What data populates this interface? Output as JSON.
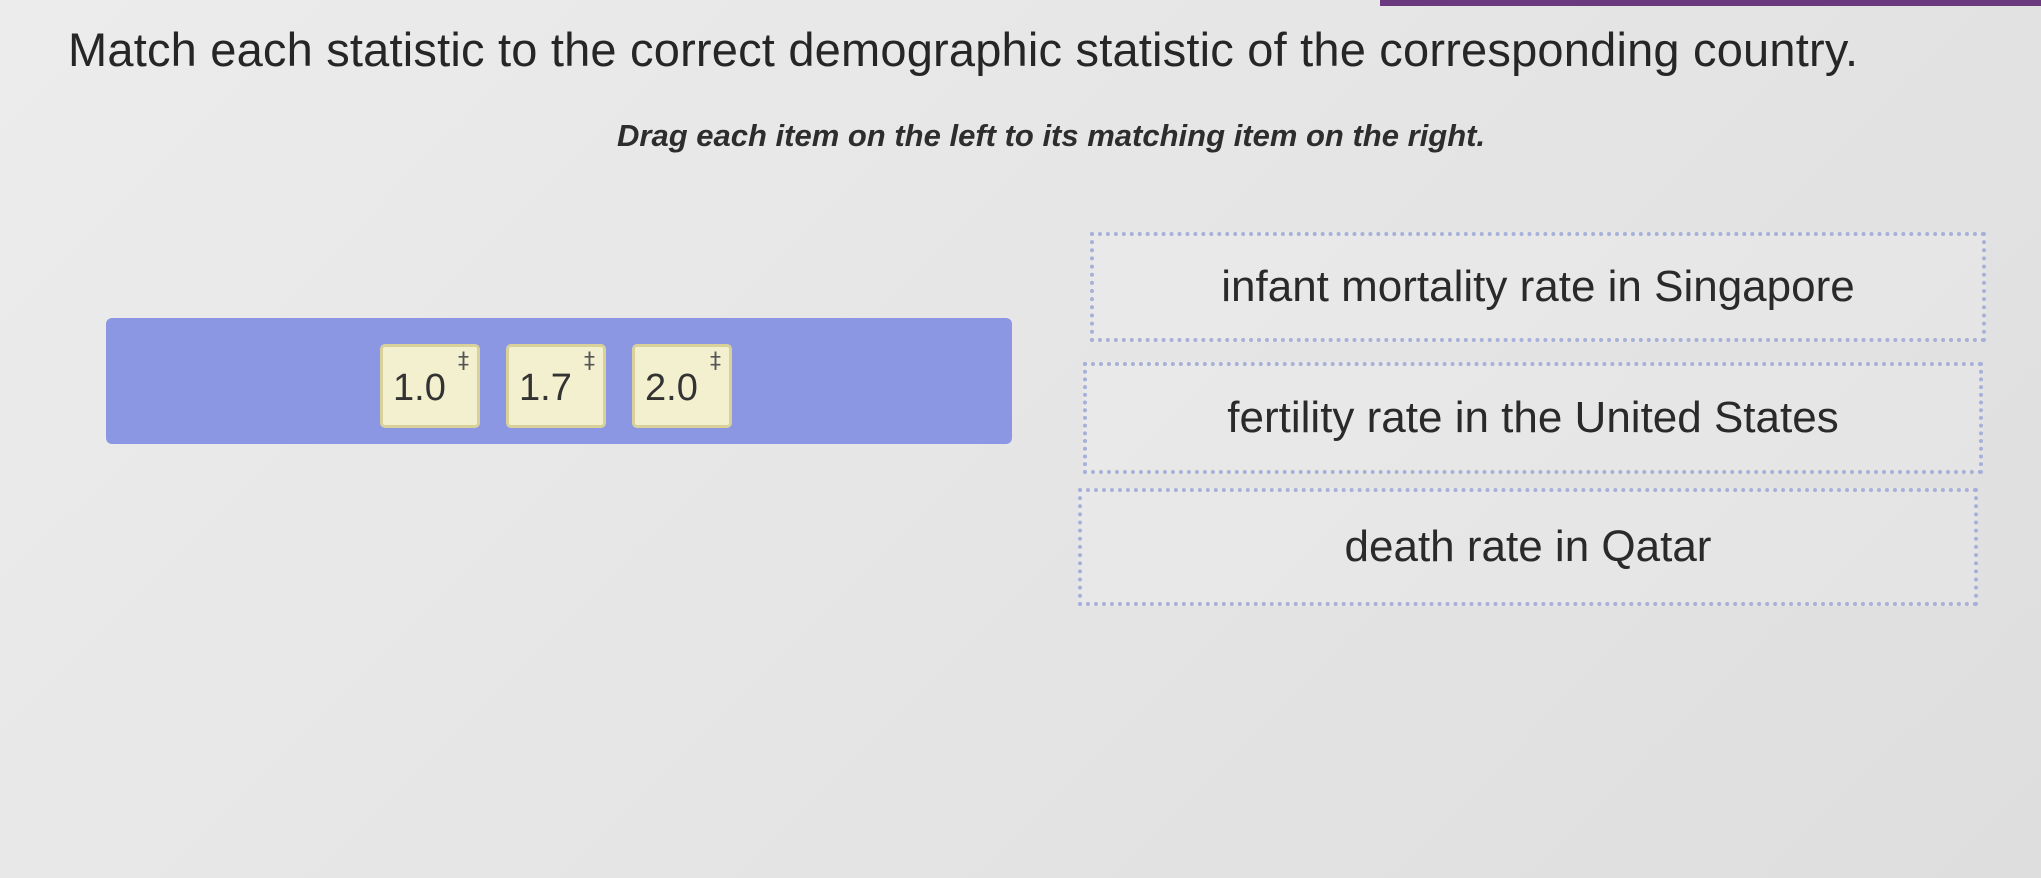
{
  "question": "Match each statistic to the correct demographic statistic of the corresponding country.",
  "instruction": "Drag each item on the left to its matching item on the right.",
  "draggables": [
    {
      "label": "1.0",
      "handle": "‡"
    },
    {
      "label": "1.7",
      "handle": "‡"
    },
    {
      "label": "2.0",
      "handle": "‡"
    }
  ],
  "targets": [
    {
      "label": "infant mortality rate in Singapore"
    },
    {
      "label": "fertility rate in the United States"
    },
    {
      "label": "death rate in Qatar"
    }
  ],
  "colors": {
    "tray": "#8b97e3",
    "chip": "#f3f0cf",
    "target_border": "#a7b0d8",
    "accent": "#6b3a7e"
  }
}
